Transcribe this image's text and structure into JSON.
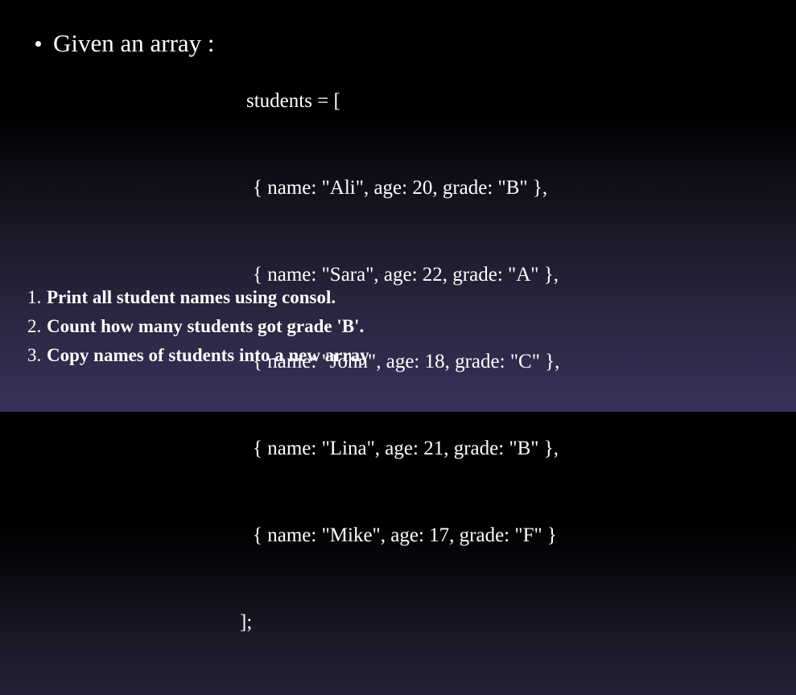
{
  "bullet": {
    "text": "Given an array :"
  },
  "code": {
    "lines": [
      "students = [",
      "{ name: \"Ali\", age: 20, grade: \"B\" },",
      "{ name: \"Sara\", age: 22, grade: \"A\" },",
      "{ name: \"John\", age: 18, grade: \"C\" },",
      "{ name: \"Lina\", age: 21, grade: \"B\" },",
      "{ name: \"Mike\", age: 17, grade: \"F\" }",
      "];"
    ]
  },
  "tasks": [
    {
      "num": "1.",
      "text": "Print all student names using consol."
    },
    {
      "num": "2.",
      "text": "Count how many students got grade 'B'."
    },
    {
      "num": "3.",
      "text": "Copy names of students into a new array"
    }
  ]
}
